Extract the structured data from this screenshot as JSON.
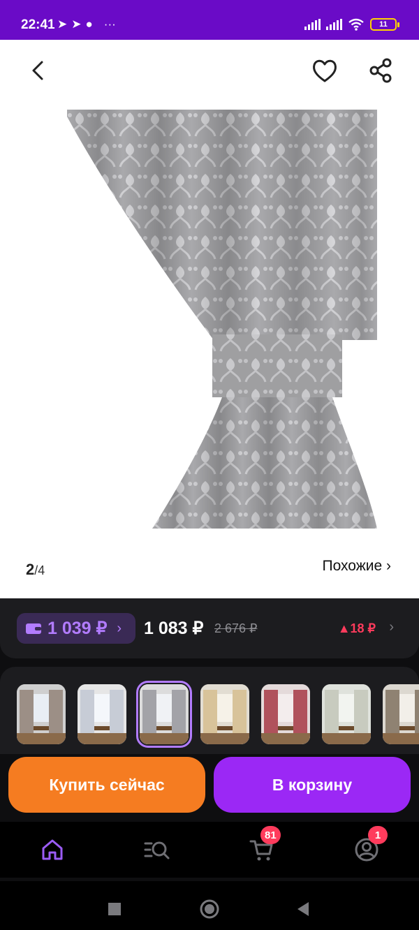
{
  "status_bar": {
    "time": "22:41",
    "battery": "11"
  },
  "header": {
    "back": "back",
    "favorite": "heart",
    "share": "share"
  },
  "gallery": {
    "current": "2",
    "separator": "/",
    "total": "4",
    "similar_label": "Похожие ›"
  },
  "price": {
    "wallet_price": "1 039 ₽",
    "main_price": "1 083 ₽",
    "old_price": "2 676 ₽",
    "change": "▲18 ₽"
  },
  "variants": {
    "selected_index": 2,
    "count": 7
  },
  "actions": {
    "buy_now": "Купить сейчас",
    "add_to_cart": "В корзину"
  },
  "nav": {
    "cart_badge": "81",
    "profile_badge": "1"
  },
  "colors": {
    "status_bar": "#6a0bc7",
    "accent_purple": "#9b28f5",
    "buy_orange": "#f57c21",
    "badge_red": "#ff3b5c"
  }
}
